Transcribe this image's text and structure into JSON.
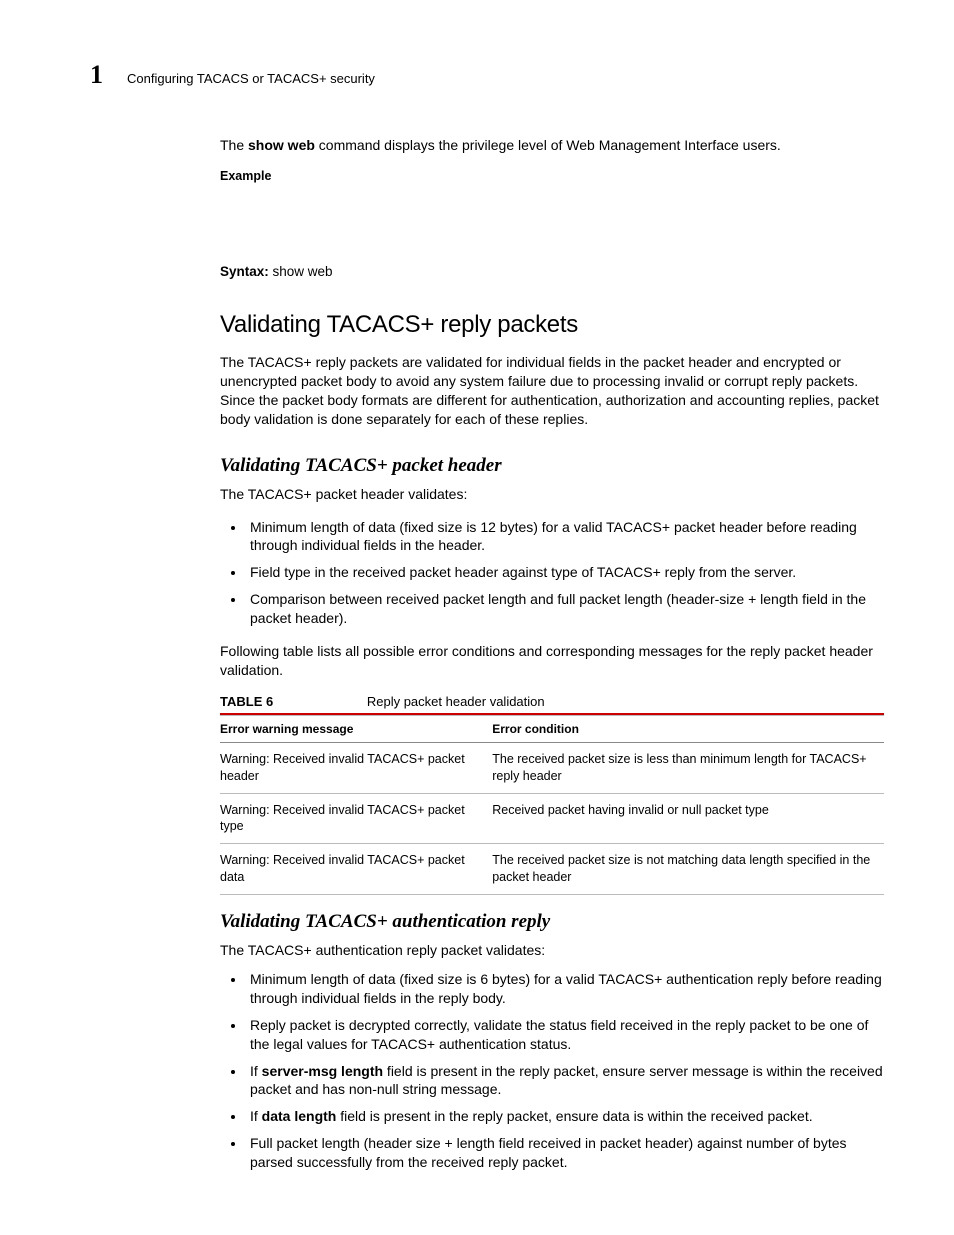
{
  "header": {
    "chapter_number": "1",
    "breadcrumb": "Configuring TACACS or TACACS+ security"
  },
  "intro": {
    "cmd_pre": "The ",
    "cmd_bold": "show web",
    "cmd_post": " command displays the privilege level of Web Management Interface users.",
    "example_label": "Example",
    "syntax_label": "Syntax:",
    "syntax_value": "  show web"
  },
  "section": {
    "title": "Validating TACACS+ reply packets",
    "para": "The TACACS+ reply packets are validated for individual fields in the packet header and encrypted or unencrypted packet body to avoid any system failure due to processing invalid or corrupt reply packets. Since the packet body formats are different for authentication, authorization and accounting replies, packet body validation is done separately for each of these replies."
  },
  "sub1": {
    "title": "Validating TACACS+ packet header",
    "intro": "The TACACS+ packet header validates:",
    "bullets": [
      "Minimum length of data (fixed size is 12 bytes) for a valid TACACS+ packet header before reading through individual fields in the header.",
      "Field type in the received packet header against type of TACACS+ reply from the server.",
      "Comparison between received packet length and full packet length (header-size + length field in the packet header)."
    ],
    "after": "Following table lists all possible error conditions and corresponding messages for the reply packet header validation."
  },
  "table": {
    "label": "TABLE 6",
    "title": "Reply packet header validation",
    "headers": [
      "Error warning message",
      "Error condition"
    ],
    "rows": [
      [
        "Warning: Received invalid TACACS+ packet header",
        "The received packet size is less than minimum length for TACACS+ reply header"
      ],
      [
        "Warning: Received invalid TACACS+ packet type",
        "Received packet having invalid or null packet type"
      ],
      [
        "Warning: Received invalid TACACS+ packet data",
        "The received packet size is not matching data length specified in the packet header"
      ]
    ]
  },
  "sub2": {
    "title": "Validating TACACS+ authentication reply",
    "intro": "The TACACS+ authentication reply packet validates:",
    "bullets": [
      {
        "pre": "Minimum length of data (fixed size is 6 bytes) for a valid TACACS+ authentication reply before reading through individual fields in the reply body."
      },
      {
        "pre": "Reply packet is decrypted correctly, validate the status field received in the reply packet to be one of the legal values for TACACS+ authentication status."
      },
      {
        "pre": "If ",
        "bold": "server-msg length",
        "post": " field is present in the reply packet, ensure server message is within the received packet and has non-null string message."
      },
      {
        "pre": "If ",
        "bold": "data length",
        "post": " field is present in the reply packet, ensure data is within the received packet."
      },
      {
        "pre": "Full packet length (header size + length field received in packet header) against number of bytes parsed successfully from the received reply packet."
      }
    ]
  }
}
